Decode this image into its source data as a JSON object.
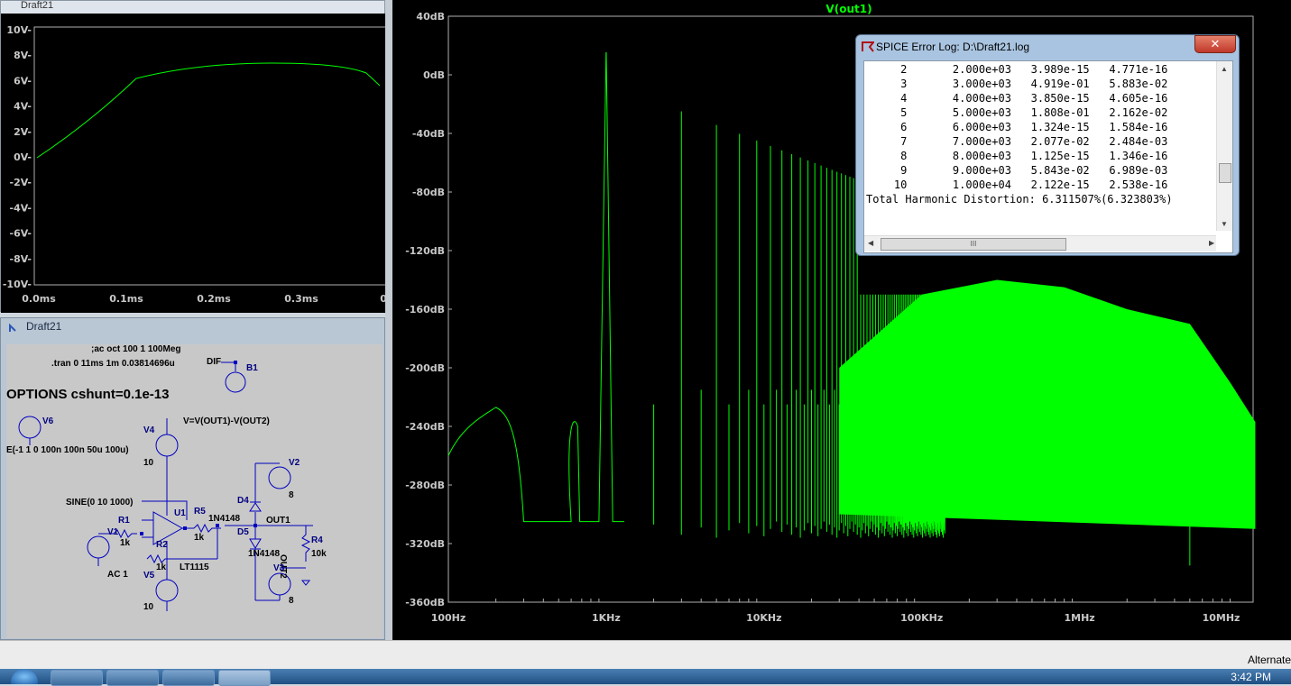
{
  "tran_window": {
    "title": "Draft21",
    "y_ticks": [
      "10V-",
      "8V-",
      "6V-",
      "4V-",
      "2V-",
      "0V-",
      "-2V-",
      "-4V-",
      "-6V-",
      "-8V-",
      "-10V-"
    ],
    "x_ticks": [
      "0.0ms",
      "0.1ms",
      "0.2ms",
      "0.3ms",
      "0.4"
    ]
  },
  "schematic_window": {
    "title": "Draft21",
    "directives": {
      "ac": ";ac oct 100 1 100Meg",
      "tran": ".tran 0 11ms 1m 0.03814696u",
      "options": "OPTIONS cshunt=0.1e-13",
      "pulse": "E(-1 1 0 100n 100n 50u 100u)",
      "bv": "V=V(OUT1)-V(OUT2)",
      "sine": "SINE(0 10 1000)",
      "ac1": "AC 1"
    },
    "labels": {
      "dif": "DIF",
      "b1": "B1",
      "v6": "V6",
      "v4": "V4",
      "v4_val": "10",
      "v2": "V2",
      "v2_val": "8",
      "d4": "D4",
      "d5": "D5",
      "d4_model": "1N4148",
      "d5_model": "1N4148",
      "u1": "U1",
      "r5": "R5",
      "r5_val": "1k",
      "r1": "R1",
      "r1_val": "1k",
      "v1": "V1",
      "r2": "R2",
      "r2_val": "1k",
      "lt": "LT1115",
      "v5": "V5",
      "v5_val": "10",
      "out1": "OUT1",
      "out2": "OUT2",
      "r4": "R4",
      "r4_val": "10k",
      "v3": "V3",
      "v3_val": "8"
    }
  },
  "spectrum": {
    "trace_label": "V(out1)",
    "y_ticks": [
      "40dB",
      "0dB",
      "-40dB",
      "-80dB",
      "-120dB",
      "-160dB",
      "-200dB",
      "-240dB",
      "-280dB",
      "-320dB",
      "-360dB"
    ],
    "x_ticks": [
      "100Hz",
      "1KHz",
      "10KHz",
      "100KHz",
      "1MHz",
      "10MHz"
    ],
    "trace_color": "#00ff00"
  },
  "error_log": {
    "title": "SPICE Error Log: D:\\Draft21.log",
    "close_label": "✕",
    "rows": [
      {
        "n": "2",
        "freq": "2.000e+03",
        "comp": "3.989e-15",
        "norm": "4.771e-16"
      },
      {
        "n": "3",
        "freq": "3.000e+03",
        "comp": "4.919e-01",
        "norm": "5.883e-02"
      },
      {
        "n": "4",
        "freq": "4.000e+03",
        "comp": "3.850e-15",
        "norm": "4.605e-16"
      },
      {
        "n": "5",
        "freq": "5.000e+03",
        "comp": "1.808e-01",
        "norm": "2.162e-02"
      },
      {
        "n": "6",
        "freq": "6.000e+03",
        "comp": "1.324e-15",
        "norm": "1.584e-16"
      },
      {
        "n": "7",
        "freq": "7.000e+03",
        "comp": "2.077e-02",
        "norm": "2.484e-03"
      },
      {
        "n": "8",
        "freq": "8.000e+03",
        "comp": "1.125e-15",
        "norm": "1.346e-16"
      },
      {
        "n": "9",
        "freq": "9.000e+03",
        "comp": "5.843e-02",
        "norm": "6.989e-03"
      },
      {
        "n": "10",
        "freq": "1.000e+04",
        "comp": "2.122e-15",
        "norm": "2.538e-16"
      }
    ],
    "thd_line": "Total Harmonic Distortion: 6.311507%(6.323803%)",
    "hscroll_grip": "III"
  },
  "status": {
    "text": "Alternate"
  },
  "taskbar": {
    "clock": "3:42 PM"
  }
}
